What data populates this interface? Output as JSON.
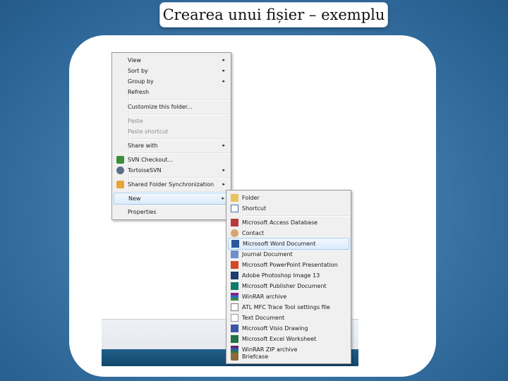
{
  "slide_title": "Crearea unui fișier – exemplu",
  "context_menu": {
    "items": [
      {
        "label": "View",
        "arrow": "▸"
      },
      {
        "label": "Sort by",
        "arrow": "▸"
      },
      {
        "label": "Group by",
        "arrow": "▸"
      },
      {
        "label": "Refresh"
      },
      {
        "label": "Customize this folder..."
      },
      {
        "label": "Paste",
        "disabled": true
      },
      {
        "label": "Paste shortcut",
        "disabled": true
      },
      {
        "label": "Share with",
        "arrow": "▸"
      },
      {
        "label": "SVN Checkout...",
        "icon": "svn-checkout-icon"
      },
      {
        "label": "TortoiseSVN",
        "icon": "tortoisesvn-icon",
        "arrow": "▸"
      },
      {
        "label": "Shared Folder Synchronization",
        "icon": "shared-folder-sync-icon",
        "arrow": "▸"
      },
      {
        "label": "New",
        "arrow": "▸",
        "highlighted": true
      },
      {
        "label": "Properties"
      }
    ]
  },
  "new_submenu": {
    "items": [
      {
        "label": "Folder",
        "icon": "folder-icon"
      },
      {
        "label": "Shortcut",
        "icon": "shortcut-icon"
      },
      {
        "label": "Microsoft Access Database",
        "icon": "access-icon"
      },
      {
        "label": "Contact",
        "icon": "contact-icon"
      },
      {
        "label": "Microsoft Word Document",
        "icon": "word-icon",
        "highlighted": true
      },
      {
        "label": "Journal Document",
        "icon": "journal-icon"
      },
      {
        "label": "Microsoft PowerPoint Presentation",
        "icon": "powerpoint-icon"
      },
      {
        "label": "Adobe Photoshop Image 13",
        "icon": "photoshop-icon"
      },
      {
        "label": "Microsoft Publisher Document",
        "icon": "publisher-icon"
      },
      {
        "label": "WinRAR archive",
        "icon": "winrar-icon"
      },
      {
        "label": "ATL MFC Trace Tool settings file",
        "icon": "atl-trace-icon"
      },
      {
        "label": "Text Document",
        "icon": "text-document-icon"
      },
      {
        "label": "Microsoft Visio Drawing",
        "icon": "visio-icon"
      },
      {
        "label": "Microsoft Excel Worksheet",
        "icon": "excel-icon"
      },
      {
        "label": "WinRAR ZIP archive",
        "icon": "winrar-zip-icon"
      },
      {
        "label": "Briefcase",
        "icon": "briefcase-icon"
      }
    ]
  },
  "colors": {
    "background": "#3d79aa",
    "menu_background": "#f0f0f0",
    "highlight": "#dcebfc"
  }
}
